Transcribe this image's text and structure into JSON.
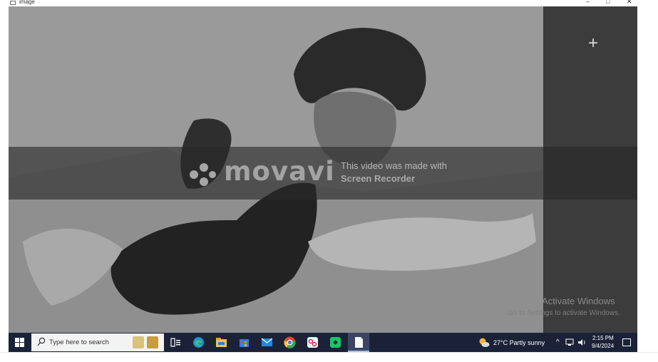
{
  "window": {
    "title": "image",
    "controls": [
      "–",
      "□",
      "✕"
    ]
  },
  "watermark": {
    "brand": "movavi",
    "line1": "This video was made with",
    "line2": "Screen Recorder"
  },
  "side_panel": {
    "add_label": "+"
  },
  "activation": {
    "title": "Activate Windows",
    "subtitle": "Go to Settings to activate Windows."
  },
  "taskbar": {
    "search_placeholder": "Type here to search",
    "weather": "27°C  Partly sunny",
    "tray_caret": "^",
    "time": "2:15 PM",
    "date": "9/4/2024"
  },
  "colors": {
    "taskbar": "#1b2238",
    "panel": "#3c3c3c",
    "banner": "#282828"
  }
}
